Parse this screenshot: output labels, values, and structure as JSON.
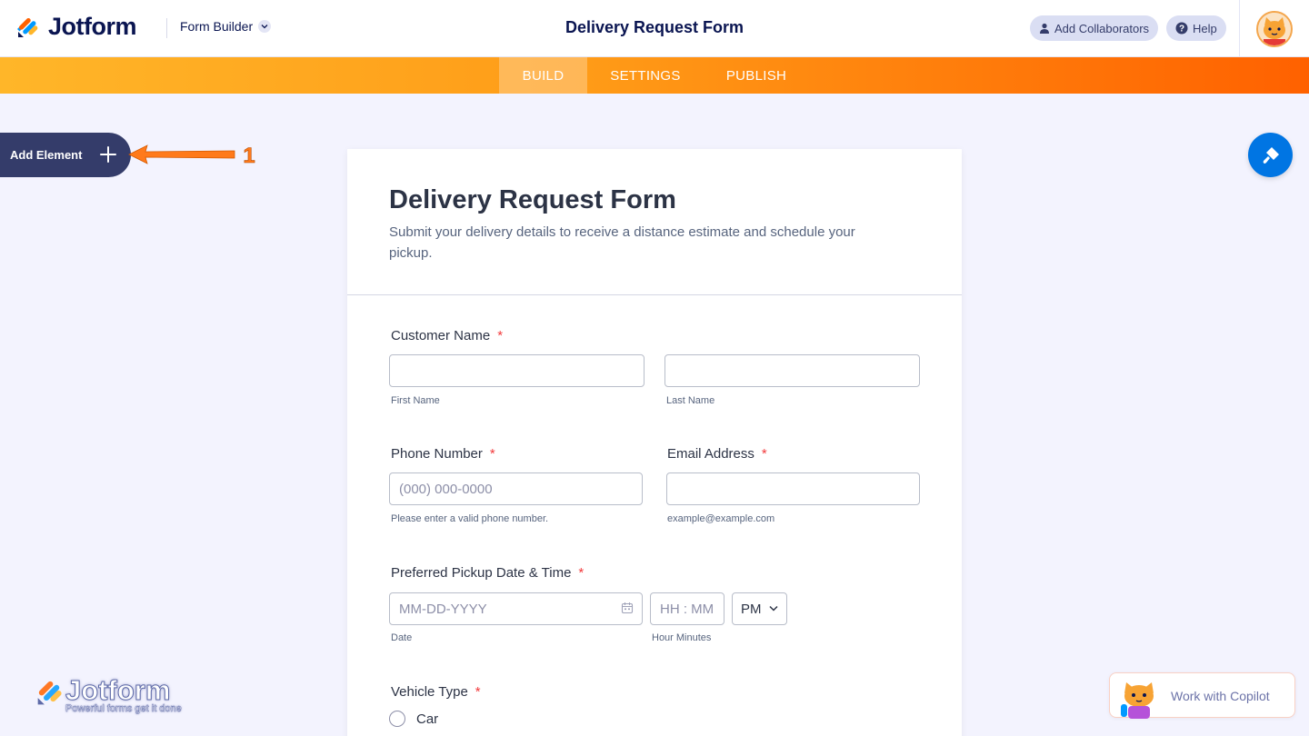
{
  "header": {
    "brand": "Jotform",
    "mode_label": "Form Builder",
    "title": "Delivery Request Form",
    "add_collaborators_label": "Add Collaborators",
    "help_label": "Help"
  },
  "nav": {
    "tabs": [
      {
        "label": "BUILD",
        "active": true
      },
      {
        "label": "SETTINGS",
        "active": false
      },
      {
        "label": "PUBLISH",
        "active": false
      }
    ]
  },
  "sidebar": {
    "add_element_label": "Add Element"
  },
  "annotation": {
    "number": "1"
  },
  "form": {
    "title": "Delivery Request Form",
    "subtitle": "Submit your delivery details to receive a distance estimate and schedule your pickup.",
    "customer_name": {
      "label": "Customer Name",
      "required": "*",
      "first_value": "",
      "last_value": "",
      "first_sublabel": "First Name",
      "last_sublabel": "Last Name"
    },
    "phone": {
      "label": "Phone Number",
      "required": "*",
      "placeholder": "(000) 000-0000",
      "sublabel": "Please enter a valid phone number."
    },
    "email": {
      "label": "Email Address",
      "required": "*",
      "value": "",
      "sublabel": "example@example.com"
    },
    "pickup": {
      "label": "Preferred Pickup Date & Time",
      "required": "*",
      "date_placeholder": "MM-DD-YYYY",
      "time_placeholder": "HH : MM",
      "ampm_value": "PM",
      "date_sublabel": "Date",
      "time_sublabel": "Hour Minutes"
    },
    "vehicle": {
      "label": "Vehicle Type",
      "required": "*",
      "options": [
        "Car"
      ]
    }
  },
  "footer": {
    "watermark_brand": "Jotform",
    "watermark_tagline": "Powerful forms get it done",
    "copilot_label": "Work with Copilot"
  },
  "colors": {
    "primary_text": "#0a1551",
    "accent_orange": "#ff6100",
    "accent_yellow": "#ffb629",
    "paint_button": "#0075e3",
    "required": "#f23a3c"
  }
}
